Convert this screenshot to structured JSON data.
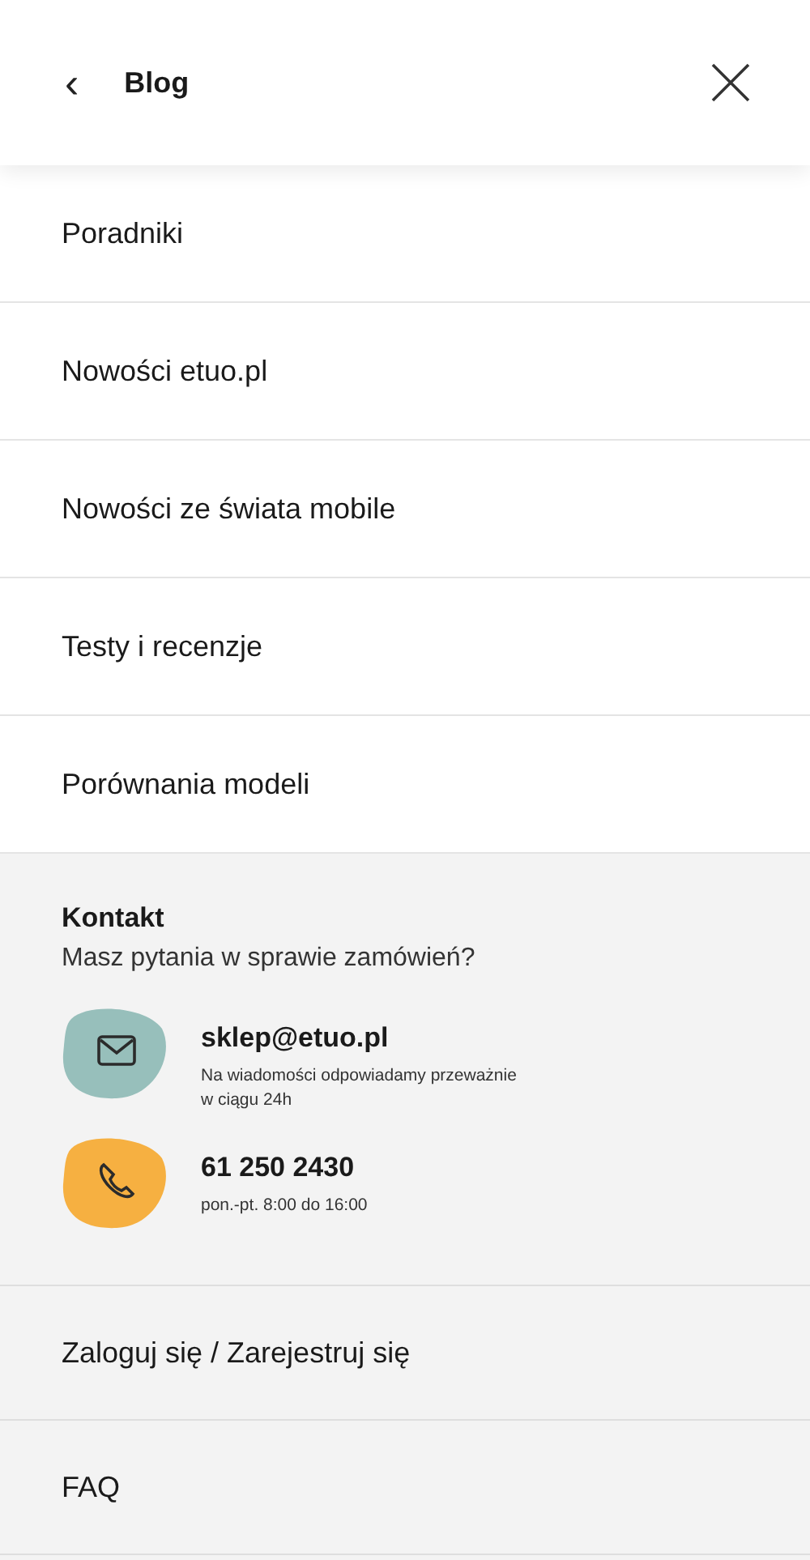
{
  "header": {
    "back": "‹",
    "title": "Blog"
  },
  "menu_items": [
    {
      "label": "Poradniki"
    },
    {
      "label": "Nowości etuo.pl"
    },
    {
      "label": "Nowości ze świata mobile"
    },
    {
      "label": "Testy i recenzje"
    },
    {
      "label": "Porównania modeli"
    }
  ],
  "contact": {
    "title": "Kontakt",
    "subtitle": "Masz pytania w sprawie zamówień?",
    "items": [
      {
        "kind": "email",
        "color": "#97bfbb",
        "main": "sklep@etuo.pl",
        "note": "Na wiadomości odpowiadamy przeważnie w ciągu 24h"
      },
      {
        "kind": "phone",
        "color": "#f6b041",
        "main": "61 250 2430",
        "note": "pon.-pt. 8:00 do 16:00"
      }
    ]
  },
  "footer_links": [
    {
      "label": "Zaloguj się / Zarejestruj się"
    },
    {
      "label": "FAQ"
    }
  ]
}
